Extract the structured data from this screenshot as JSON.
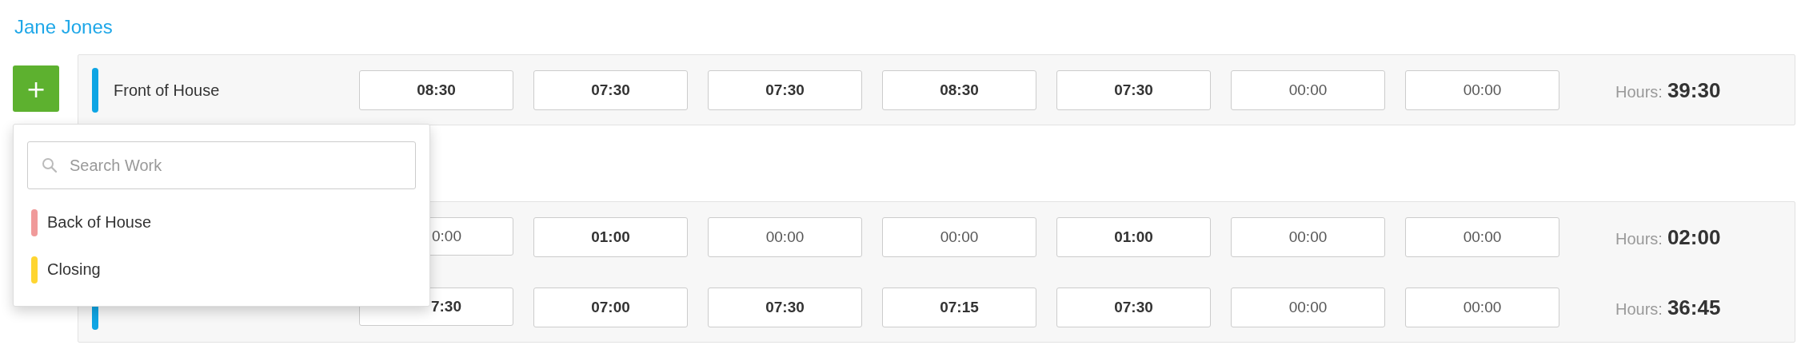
{
  "employee": {
    "name": "Jane Jones"
  },
  "add_button": {
    "label": "+"
  },
  "groups": [
    {
      "rows": [
        {
          "label": "Front of House",
          "color": "#0ea5e4",
          "times": [
            {
              "value": "08:30",
              "bold": true
            },
            {
              "value": "07:30",
              "bold": true
            },
            {
              "value": "07:30",
              "bold": true
            },
            {
              "value": "08:30",
              "bold": true
            },
            {
              "value": "07:30",
              "bold": true
            },
            {
              "value": "00:00",
              "bold": false
            },
            {
              "value": "00:00",
              "bold": false
            }
          ],
          "hours_label": "Hours:",
          "hours_value": "39:30"
        }
      ]
    },
    {
      "rows": [
        {
          "times": [
            {
              "value": "0:00",
              "bold": false
            },
            {
              "value": "01:00",
              "bold": true
            },
            {
              "value": "00:00",
              "bold": false
            },
            {
              "value": "00:00",
              "bold": false
            },
            {
              "value": "01:00",
              "bold": true
            },
            {
              "value": "00:00",
              "bold": false
            },
            {
              "value": "00:00",
              "bold": false
            }
          ],
          "hours_label": "Hours:",
          "hours_value": "02:00"
        },
        {
          "color": "#0ea5e4",
          "times": [
            {
              "value": "7:30",
              "bold": true
            },
            {
              "value": "07:00",
              "bold": true
            },
            {
              "value": "07:30",
              "bold": true
            },
            {
              "value": "07:15",
              "bold": true
            },
            {
              "value": "07:30",
              "bold": true
            },
            {
              "value": "00:00",
              "bold": false
            },
            {
              "value": "00:00",
              "bold": false
            }
          ],
          "hours_label": "Hours:",
          "hours_value": "36:45"
        }
      ]
    }
  ],
  "dropdown": {
    "search": {
      "placeholder": "Search Work"
    },
    "items": [
      {
        "label": "Back of House",
        "color": "#f09a9a"
      },
      {
        "label": "Closing",
        "color": "#fed531"
      }
    ]
  }
}
